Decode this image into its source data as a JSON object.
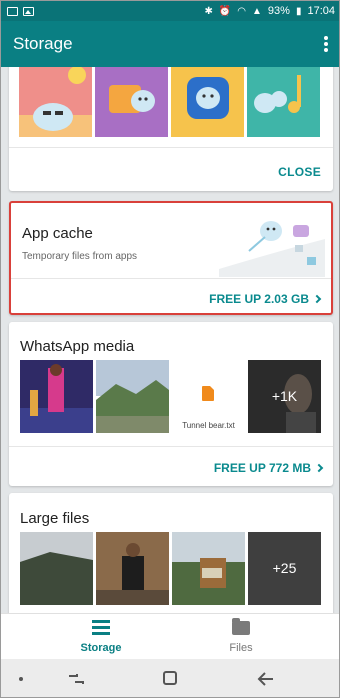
{
  "status_bar": {
    "battery": "93%",
    "time": "17:04"
  },
  "app_bar": {
    "title": "Storage"
  },
  "cards": {
    "promo": {
      "close_label": "CLOSE"
    },
    "app_cache": {
      "title": "App cache",
      "subtitle": "Temporary files from apps",
      "action_label": "FREE UP 2.03 GB"
    },
    "whatsapp": {
      "title": "WhatsApp media",
      "file_name": "Tunnel bear.txt",
      "more_count": "+1K",
      "action_label": "FREE UP 772 MB"
    },
    "large_files": {
      "title": "Large files",
      "more_count": "+25"
    }
  },
  "bottom_nav": {
    "items": [
      {
        "label": "Storage",
        "icon": "storage-icon",
        "active": true
      },
      {
        "label": "Files",
        "icon": "folder-icon",
        "active": false
      }
    ]
  },
  "colors": {
    "primary": "#0a7f83",
    "accent_text": "#0a8a8e",
    "highlight_border": "#d9403a"
  }
}
